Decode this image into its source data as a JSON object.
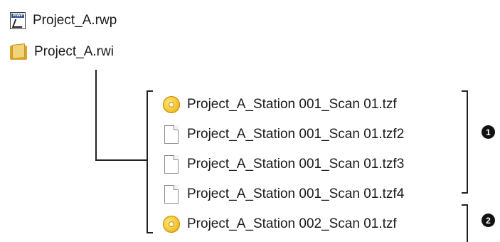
{
  "items": [
    {
      "label": "Project_A.rwp",
      "icon": "project-file-icon"
    },
    {
      "label": "Project_A.rwi",
      "icon": "folder-icon"
    },
    {
      "label": "Project_A_Station 001_Scan 01.tzf",
      "icon": "scan-file-icon"
    },
    {
      "label": "Project_A_Station 001_Scan 01.tzf2",
      "icon": "document-icon"
    },
    {
      "label": "Project_A_Station 001_Scan 01.tzf3",
      "icon": "document-icon"
    },
    {
      "label": "Project_A_Station 001_Scan 01.tzf4",
      "icon": "document-icon"
    },
    {
      "label": "Project_A_Station 002_Scan 01.tzf",
      "icon": "scan-file-icon"
    }
  ],
  "markers": [
    "1",
    "2"
  ]
}
